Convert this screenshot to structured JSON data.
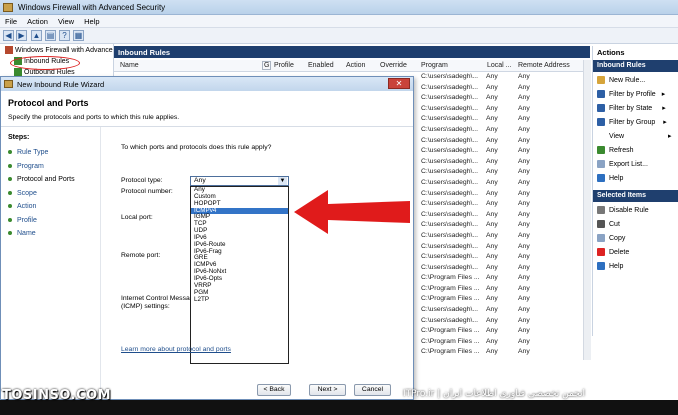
{
  "window": {
    "title": "Windows Firewall with Advanced Security"
  },
  "menu": [
    "File",
    "Action",
    "View",
    "Help"
  ],
  "tree": {
    "root": "Windows Firewall with Advance",
    "inbound": "Inbound Rules",
    "outbound": "Outbound Rules"
  },
  "list": {
    "header": "Inbound Rules",
    "columns": [
      "Name",
      "Profile",
      "Enabled",
      "Action",
      "Override",
      "Program",
      "Local ...",
      "Remote Address"
    ],
    "rows": [
      [
        "C:\\users\\sadegh\\...",
        "Any",
        "Any"
      ],
      [
        "C:\\users\\sadegh\\...",
        "Any",
        "Any"
      ],
      [
        "C:\\users\\sadegh\\...",
        "Any",
        "Any"
      ],
      [
        "C:\\users\\sadegh\\...",
        "Any",
        "Any"
      ],
      [
        "C:\\users\\sadegh\\...",
        "Any",
        "Any"
      ],
      [
        "C:\\users\\sadegh\\...",
        "Any",
        "Any"
      ],
      [
        "C:\\users\\sadegh\\...",
        "Any",
        "Any"
      ],
      [
        "C:\\users\\sadegh\\...",
        "Any",
        "Any"
      ],
      [
        "C:\\users\\sadegh\\...",
        "Any",
        "Any"
      ],
      [
        "C:\\users\\sadegh\\...",
        "Any",
        "Any"
      ],
      [
        "C:\\users\\sadegh\\...",
        "Any",
        "Any"
      ],
      [
        "C:\\users\\sadegh\\...",
        "Any",
        "Any"
      ],
      [
        "C:\\users\\sadegh\\...",
        "Any",
        "Any"
      ],
      [
        "C:\\users\\sadegh\\...",
        "Any",
        "Any"
      ],
      [
        "C:\\users\\sadegh\\...",
        "Any",
        "Any"
      ],
      [
        "C:\\users\\sadegh\\...",
        "Any",
        "Any"
      ],
      [
        "C:\\users\\sadegh\\...",
        "Any",
        "Any"
      ],
      [
        "C:\\users\\sadegh\\...",
        "Any",
        "Any"
      ],
      [
        "C:\\users\\sadegh\\...",
        "Any",
        "Any"
      ],
      [
        "C:\\Program Files ...",
        "Any",
        "Any"
      ],
      [
        "C:\\Program Files ...",
        "Any",
        "Any"
      ],
      [
        "C:\\Program Files ...",
        "Any",
        "Any"
      ],
      [
        "C:\\users\\sadegh\\...",
        "Any",
        "Any"
      ],
      [
        "C:\\users\\sadegh\\...",
        "Any",
        "Any"
      ],
      [
        "C:\\Program Files ...",
        "Any",
        "Any"
      ],
      [
        "C:\\Program Files ...",
        "Any",
        "Any"
      ],
      [
        "C:\\Program Files ...",
        "Any",
        "Any"
      ]
    ]
  },
  "actions": {
    "title": "Actions",
    "section1": "Inbound Rules",
    "items1": [
      "New Rule...",
      "Filter by Profile",
      "Filter by State",
      "Filter by Group",
      "View",
      "Refresh",
      "Export List...",
      "Help"
    ],
    "section2": "Selected Items",
    "items2": [
      "Disable Rule",
      "Cut",
      "Copy",
      "Delete",
      "Help"
    ]
  },
  "wizard": {
    "title": "New Inbound Rule Wizard",
    "heading": "Protocol and Ports",
    "subheading": "Specify the protocols and ports to which this rule applies.",
    "steps_label": "Steps:",
    "steps": [
      "Rule Type",
      "Program",
      "Protocol and Ports",
      "Scope",
      "Action",
      "Profile",
      "Name"
    ],
    "question": "To which ports and protocols does this rule apply?",
    "protocol_type_label": "Protocol type:",
    "protocol_type_value": "Any",
    "protocol_number_label": "Protocol number:",
    "local_port_label": "Local port:",
    "remote_port_label": "Remote port:",
    "icmp_label_1": "Internet Control Message",
    "icmp_label_2": "(ICMP) settings:",
    "options": [
      "Any",
      "Custom",
      "HOPOPT",
      "ICMPv4",
      "IGMP",
      "TCP",
      "UDP",
      "IPv6",
      "IPv6-Route",
      "IPv6-Frag",
      "GRE",
      "ICMPv6",
      "IPv6-NoNxt",
      "IPv6-Opts",
      "VRRP",
      "PGM",
      "L2TP"
    ],
    "selected_option": "ICMPv4",
    "learn_link": "Learn more about protocol and ports",
    "back": "< Back",
    "next": "Next >",
    "cancel": "Cancel"
  },
  "watermark": {
    "left": "TOSINSO.COM",
    "right": "ITPro.ir | انجمن تخصصی فناوری اطلاعات ایران"
  },
  "colors": {
    "accent": "#1f3f6e",
    "selection": "#3374c7",
    "arrow": "#e01b1b"
  }
}
